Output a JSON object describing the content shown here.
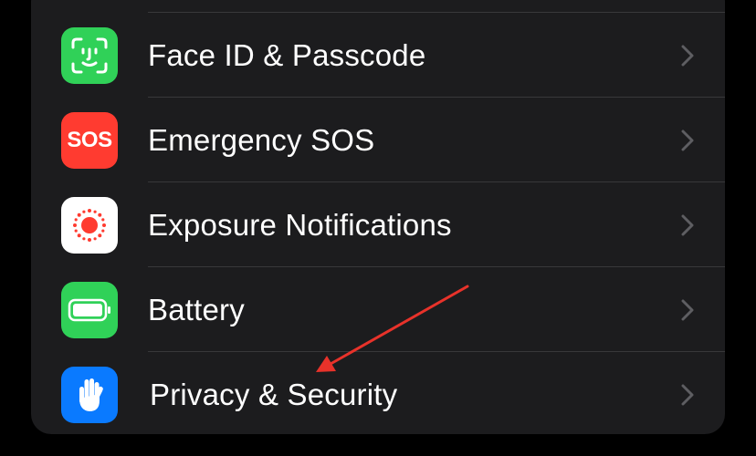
{
  "settings": {
    "items": [
      {
        "label": "Face ID & Passcode",
        "icon": "face-id-icon",
        "icon_bg": "#30d158"
      },
      {
        "label": "Emergency SOS",
        "icon": "sos-icon",
        "icon_text": "SOS",
        "icon_bg": "#ff3b30"
      },
      {
        "label": "Exposure Notifications",
        "icon": "exposure-notifications-icon",
        "icon_bg": "#ffffff"
      },
      {
        "label": "Battery",
        "icon": "battery-icon",
        "icon_bg": "#30d158"
      },
      {
        "label": "Privacy & Security",
        "icon": "hand-icon",
        "icon_bg": "#0a7aff"
      }
    ]
  },
  "annotation": {
    "color": "#e8322a",
    "points_to": "Privacy & Security"
  },
  "colors": {
    "background": "#000000",
    "group_background": "#1c1c1e",
    "separator": "#38383a",
    "chevron": "#5e5e62",
    "text": "#ffffff"
  }
}
